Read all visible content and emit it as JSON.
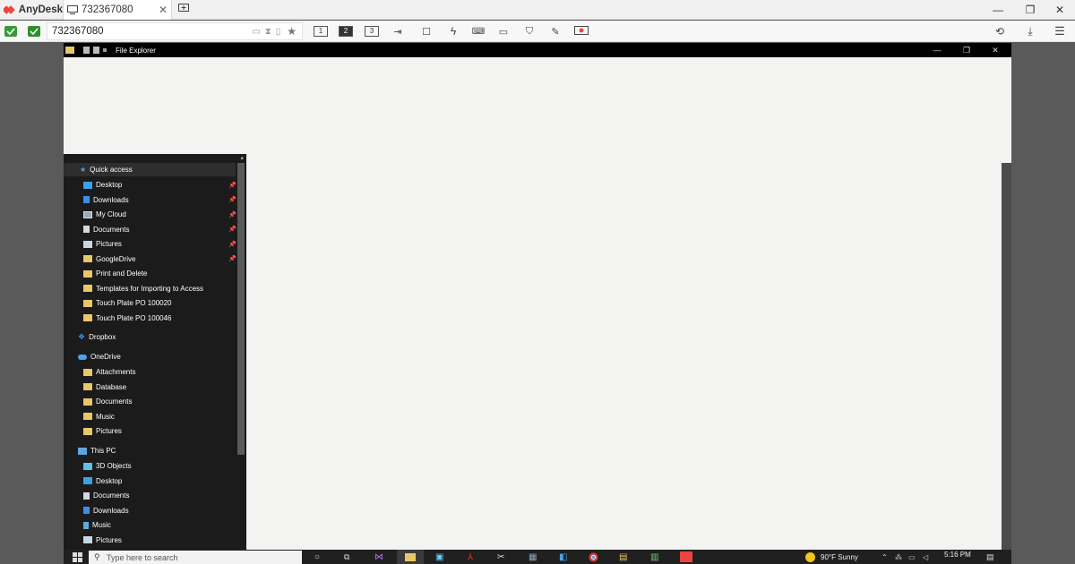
{
  "app": {
    "name": "AnyDesk",
    "tab_label": "732367080",
    "address_value": "732367080"
  },
  "toolbar": {
    "monitors": [
      "1",
      "2",
      "3"
    ],
    "active_monitor": "2"
  },
  "remote": {
    "window_title": "File Explorer",
    "nav": {
      "quick_access": "Quick access",
      "quick_items": [
        {
          "label": "Desktop",
          "icon": "desktop-icon",
          "pinned": true
        },
        {
          "label": "Downloads",
          "icon": "download-icon",
          "pinned": true
        },
        {
          "label": "My Cloud",
          "icon": "cloud-drive-icon",
          "pinned": true
        },
        {
          "label": "Documents",
          "icon": "document-icon",
          "pinned": true
        },
        {
          "label": "Pictures",
          "icon": "pictures-icon",
          "pinned": true
        },
        {
          "label": "GoogleDrive",
          "icon": "folder-icon",
          "pinned": true
        },
        {
          "label": "Print and Delete",
          "icon": "folder-icon",
          "pinned": false
        },
        {
          "label": "Templates for Importing to Access",
          "icon": "folder-icon",
          "pinned": false
        },
        {
          "label": "Touch Plate PO 100020",
          "icon": "folder-icon",
          "pinned": false
        },
        {
          "label": "Touch Plate PO 100046",
          "icon": "folder-icon",
          "pinned": false
        }
      ],
      "dropbox": "Dropbox",
      "onedrive": "OneDrive",
      "onedrive_items": [
        "Attachments",
        "Database",
        "Documents",
        "Music",
        "Pictures"
      ],
      "this_pc": "This PC",
      "pc_items": [
        {
          "label": "3D Objects",
          "icon": "3d-objects-icon"
        },
        {
          "label": "Desktop",
          "icon": "desktop-icon"
        },
        {
          "label": "Documents",
          "icon": "document-icon"
        },
        {
          "label": "Downloads",
          "icon": "download-icon"
        },
        {
          "label": "Music",
          "icon": "music-icon"
        },
        {
          "label": "Pictures",
          "icon": "pictures-icon"
        }
      ]
    },
    "taskbar": {
      "search_placeholder": "Type here to search",
      "weather": "90°F  Sunny",
      "clock": "5:16 PM"
    }
  },
  "colors": {
    "folder": "#e8c66a",
    "desktop_blue": "#3ba0e8",
    "onedrive_blue": "#4aa3ea",
    "anydesk_red": "#ef443b"
  }
}
